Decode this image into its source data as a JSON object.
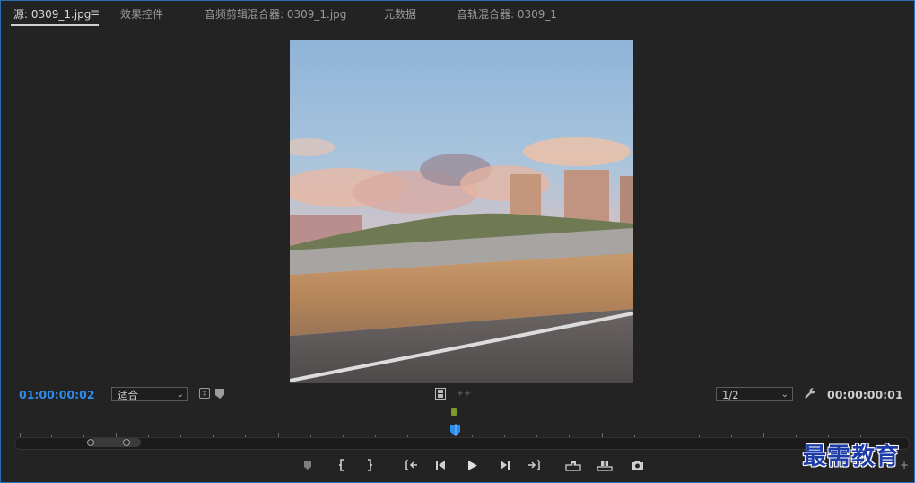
{
  "tabs": {
    "source": "源: 0309_1.jpg",
    "menu": "≡",
    "effect_controls": "效果控件",
    "audio_clip_mixer": "音频剪辑混合器: 0309_1.jpg",
    "metadata": "元数据",
    "audio_track_mixer": "音轨混合器: 0309_1"
  },
  "controls": {
    "playhead_timecode": "01:00:00:02",
    "zoom_select": "适合",
    "resolution_select": "1/2",
    "duration_timecode": "00:00:00:01"
  },
  "colors": {
    "accent": "#2d8ceb",
    "panel_border": "#2d6fb0",
    "playhead": "#2d8ceb",
    "in_marker": "#7a9a2c"
  },
  "icons": {
    "zoom_chevron": "chevron-down-icon",
    "resolution_chevron": "chevron-down-icon",
    "settings": "wrench-icon",
    "export_frame": "camera-icon"
  },
  "watermark": "最需教育"
}
